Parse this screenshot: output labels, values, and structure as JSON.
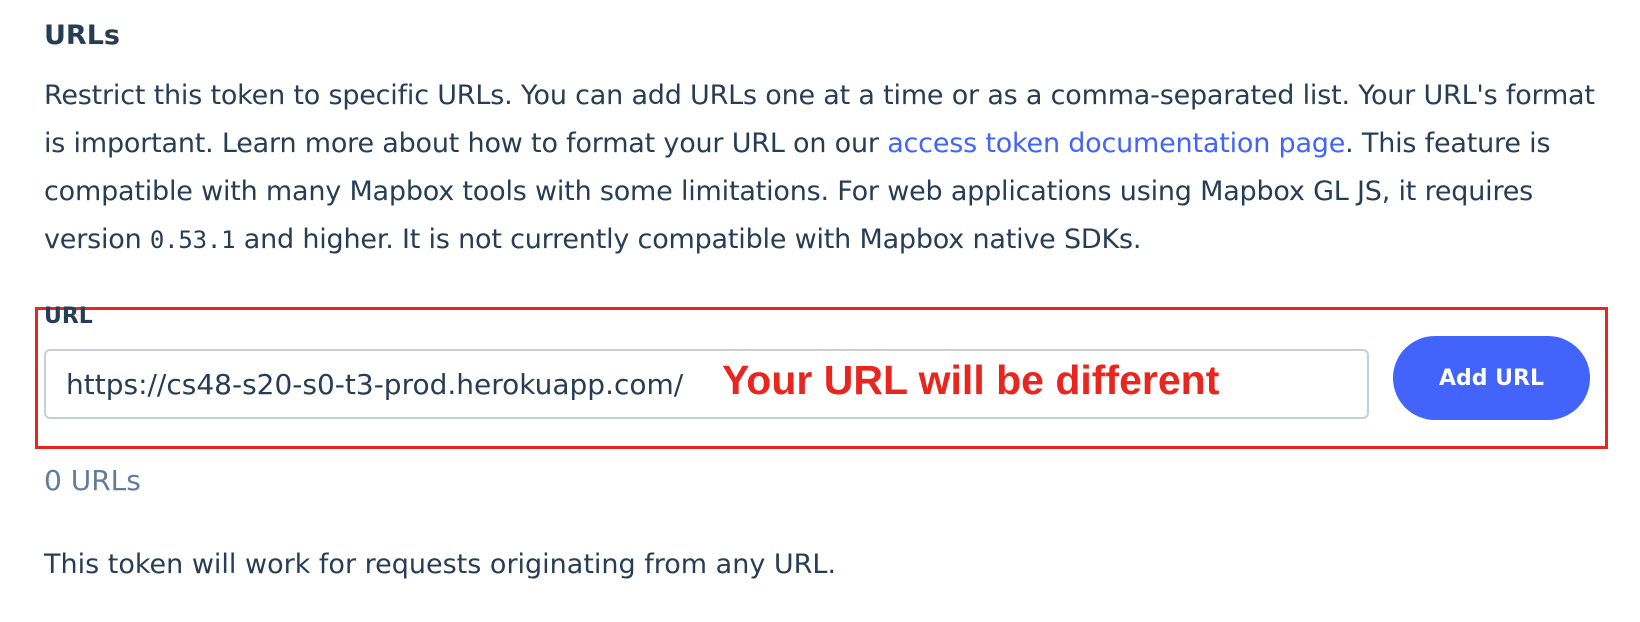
{
  "section": {
    "heading": "URLs",
    "description": {
      "part1": "Restrict this token to specific URLs. You can add URLs one at a time or as a comma-separated list. Your URL's format is important. Learn more about how to format your URL on our ",
      "link_text": "access token documentation page",
      "part2": ". This feature is compatible with many Mapbox tools with some limitations. For web applications using Mapbox GL JS, it requires version ",
      "version": "0.53.1",
      "part3": " and higher. It is not currently compatible with Mapbox native SDKs."
    }
  },
  "url_form": {
    "label": "URL",
    "input_value": "https://cs48-s20-s0-t3-prod.herokuapp.com/",
    "add_button_label": "Add URL"
  },
  "annotation": {
    "text": "Your URL will be different",
    "color": "#e8261f"
  },
  "url_count": "0 URLs",
  "note": "This token will work for requests originating from any URL.",
  "colors": {
    "text": "#273d56",
    "link": "#4264fb",
    "button_bg": "#4264fb",
    "muted": "#607d9c",
    "input_border": "#c6cfd9"
  }
}
